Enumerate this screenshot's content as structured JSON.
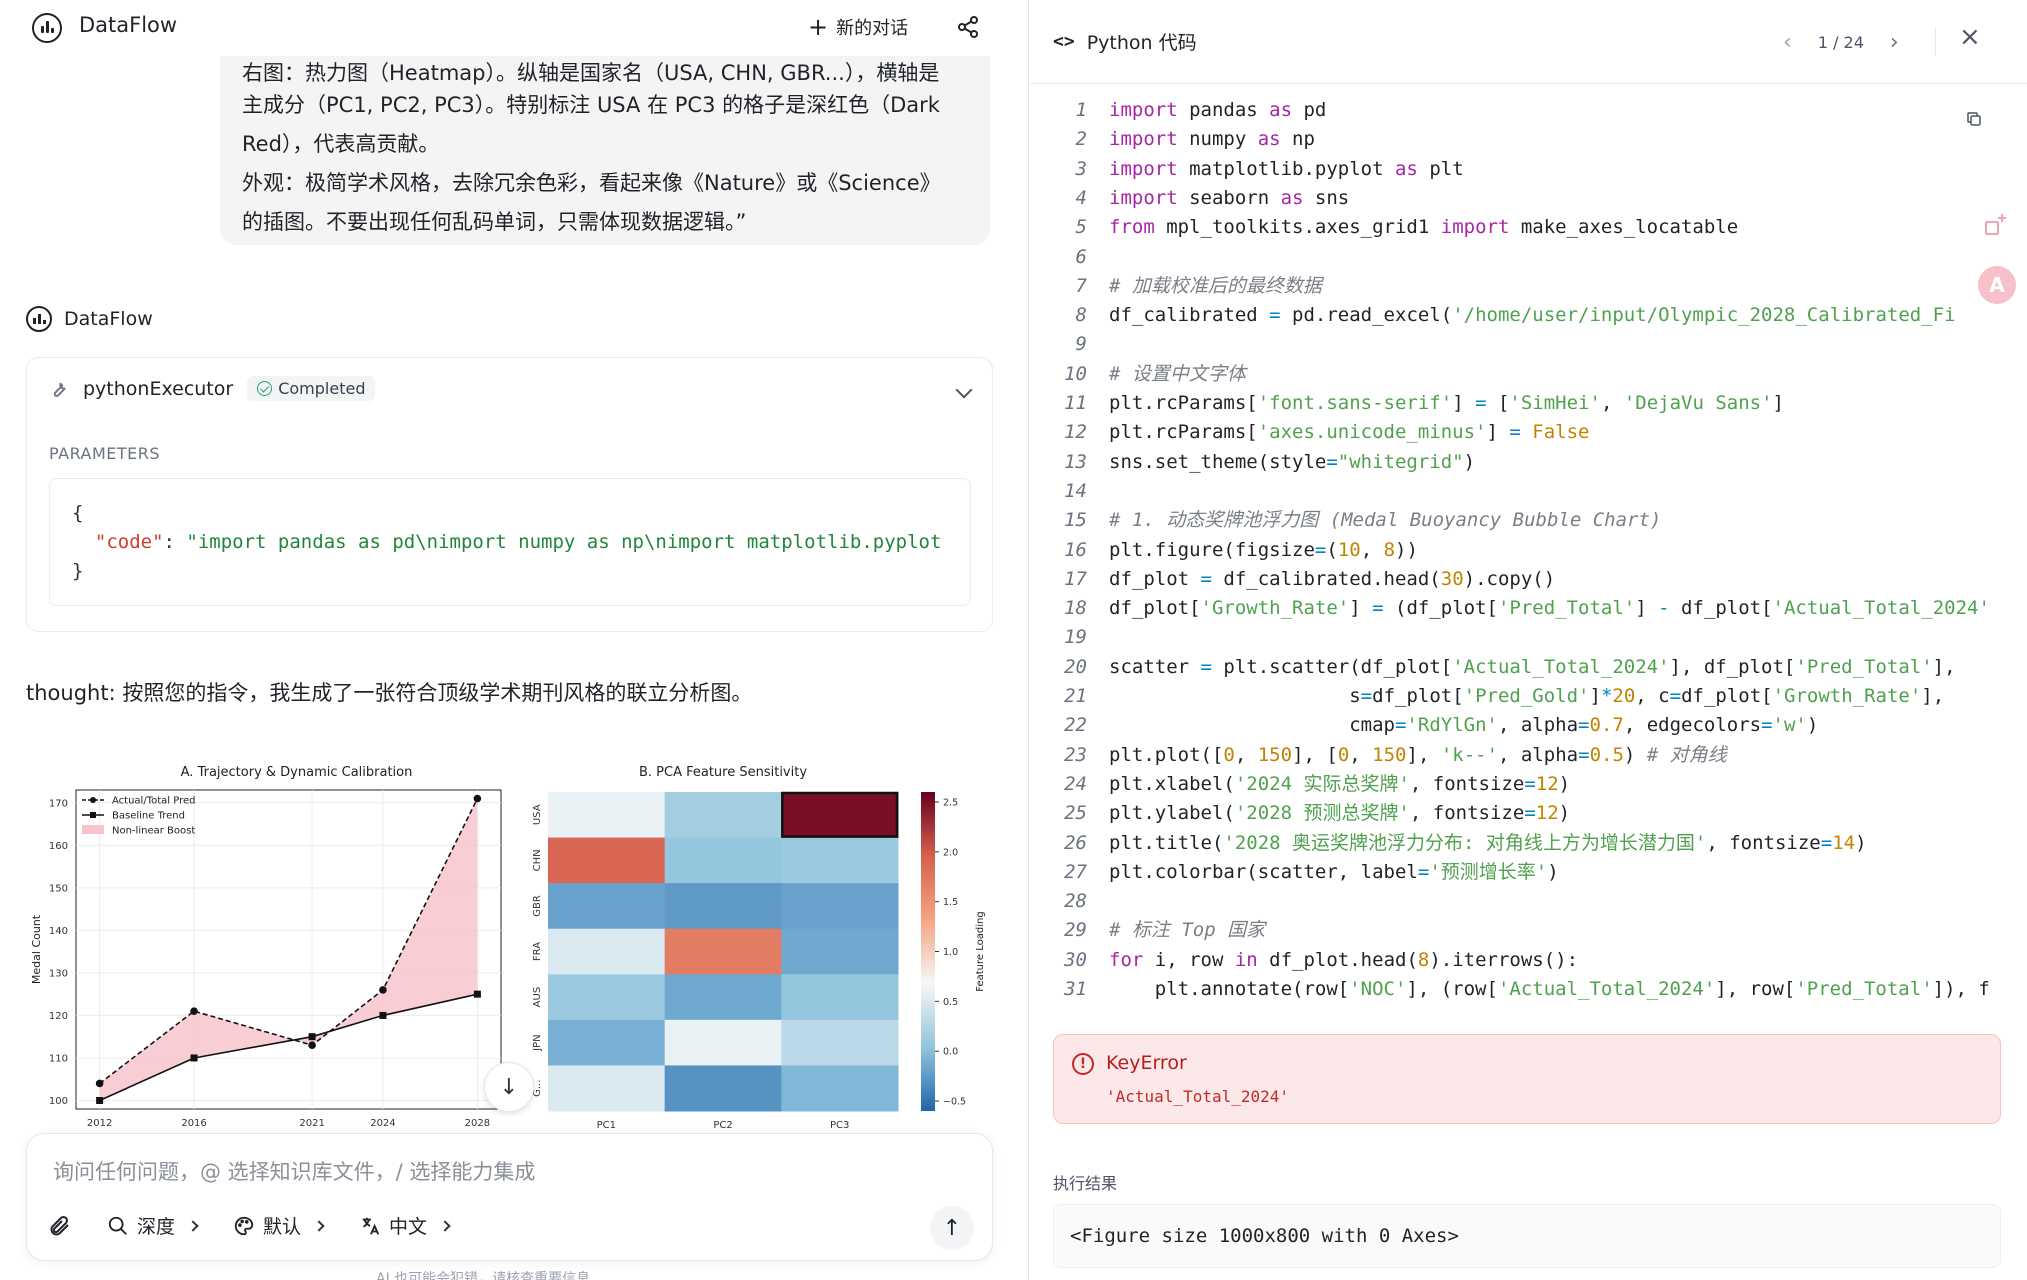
{
  "app": {
    "name": "DataFlow"
  },
  "header": {
    "new_chat_label": "新的对话",
    "share_icon": "share-icon"
  },
  "user_message": {
    "cut_line": "右图：热力图（Heatmap）。纵轴是国家名（USA, CHN, GBR...），横轴是",
    "lines": [
      "主成分（PC1, PC2, PC3）。特别标注 USA 在 PC3 的格子是深红色（Dark",
      "Red），代表高贡献。",
      "外观：极简学术风格，去除冗余色彩，看起来像《Nature》或《Science》",
      "的插图。不要出现任何乱码单词，只需体现数据逻辑。”"
    ]
  },
  "assistant": {
    "name": "DataFlow",
    "tool_call": {
      "name": "pythonExecutor",
      "status": "Completed",
      "params_label": "PARAMETERS",
      "open_brace": "{",
      "code_key": "\"code\"",
      "colon": ": ",
      "code_value": "\"import pandas as pd\\nimport numpy as np\\nimport matplotlib.pyplot",
      "close_brace": "}"
    },
    "thought": "thought: 按照您的指令，我生成了一张符合顶级学术期刊风格的联立分析图。"
  },
  "chart_data": [
    {
      "type": "line",
      "title": "A. Trajectory & Dynamic Calibration",
      "xlabel": "",
      "ylabel": "Medal Count",
      "x": [
        "2012",
        "2016",
        "2021",
        "2024",
        "2028"
      ],
      "x_numeric": [
        2012,
        2016,
        2021,
        2024,
        2028
      ],
      "ylim": [
        98,
        173
      ],
      "yticks": [
        100,
        110,
        120,
        130,
        140,
        150,
        160,
        170
      ],
      "series": [
        {
          "name": "Actual/Total Pred",
          "values": [
            104,
            121,
            113,
            126,
            171
          ],
          "style": "dashed",
          "marker": "circle"
        },
        {
          "name": "Baseline Trend",
          "values": [
            100,
            110,
            115,
            120,
            125
          ],
          "style": "solid",
          "marker": "square"
        }
      ],
      "fill": {
        "name": "Non-linear Boost",
        "color": "#f7c4cc"
      },
      "legend": "top-left",
      "grid": true
    },
    {
      "type": "heatmap",
      "title": "B. PCA Feature Sensitivity",
      "rows": [
        "USA",
        "CHN",
        "GBR",
        "FRA",
        "AUS",
        "JPN",
        "GER"
      ],
      "row_labels_shown": [
        "USA",
        "CHN",
        "GBR",
        "FRA",
        "AUS",
        "JPN",
        "G..."
      ],
      "columns": [
        "PC1",
        "PC2",
        "PC3"
      ],
      "values": [
        [
          0.6,
          0.15,
          2.5
        ],
        [
          1.9,
          0.05,
          0.1
        ],
        [
          -0.2,
          -0.25,
          -0.2
        ],
        [
          0.5,
          1.7,
          -0.15
        ],
        [
          0.1,
          -0.15,
          0.05
        ],
        [
          -0.1,
          0.6,
          0.3
        ],
        [
          0.5,
          -0.3,
          -0.05
        ]
      ],
      "highlight": {
        "row": "USA",
        "column": "PC3"
      },
      "colorbar": {
        "label": "Feature Loading",
        "ticks": [
          2.5,
          2.0,
          1.5,
          1.0,
          0.5,
          0.0,
          -0.5
        ],
        "tick_labels": [
          "2.5",
          "2.0",
          "1.5",
          "1.0",
          "0.5",
          "0.0",
          "−0.5"
        ],
        "range": [
          -0.6,
          2.6
        ]
      },
      "colormap": "RdBu_r"
    }
  ],
  "composer": {
    "placeholder": "询问任何问题，@ 选择知识库文件，/ 选择能力集成",
    "attach_icon": "paperclip-icon",
    "tools": [
      {
        "label": "深度",
        "icon": "search-icon"
      },
      {
        "label": "默认",
        "icon": "palette-icon"
      },
      {
        "label": "中文",
        "icon": "translate-icon"
      }
    ],
    "send_icon": "arrow-up-icon",
    "footer": "AI 也可能会犯错，请核查重要信息"
  },
  "code_panel": {
    "title": "Python 代码",
    "pager": "1 / 24",
    "lines": [
      [
        [
          "kw",
          "import"
        ],
        [
          "tx",
          " pandas "
        ],
        [
          "kw",
          "as"
        ],
        [
          "tx",
          " pd"
        ]
      ],
      [
        [
          "kw",
          "import"
        ],
        [
          "tx",
          " numpy "
        ],
        [
          "kw",
          "as"
        ],
        [
          "tx",
          " np"
        ]
      ],
      [
        [
          "kw",
          "import"
        ],
        [
          "tx",
          " matplotlib.pyplot "
        ],
        [
          "kw",
          "as"
        ],
        [
          "tx",
          " plt"
        ]
      ],
      [
        [
          "kw",
          "import"
        ],
        [
          "tx",
          " seaborn "
        ],
        [
          "kw",
          "as"
        ],
        [
          "tx",
          " sns"
        ]
      ],
      [
        [
          "kw",
          "from"
        ],
        [
          "tx",
          " mpl_toolkits.axes_grid1 "
        ],
        [
          "kw",
          "import"
        ],
        [
          "tx",
          " make_axes_locatable"
        ]
      ],
      [],
      [
        [
          "cm",
          "# 加载校准后的最终数据"
        ]
      ],
      [
        [
          "tx",
          "df_calibrated "
        ],
        [
          "op",
          "="
        ],
        [
          "tx",
          " pd.read_excel("
        ],
        [
          "st",
          "'/home/user/input/Olympic_2028_Calibrated_Fi"
        ]
      ],
      [],
      [
        [
          "cm",
          "# 设置中文字体"
        ]
      ],
      [
        [
          "tx",
          "plt.rcParams["
        ],
        [
          "st",
          "'font.sans-serif'"
        ],
        [
          "tx",
          "] "
        ],
        [
          "op",
          "="
        ],
        [
          "tx",
          " ["
        ],
        [
          "st",
          "'SimHei'"
        ],
        [
          "tx",
          ", "
        ],
        [
          "st",
          "'DejaVu Sans'"
        ],
        [
          "tx",
          "]"
        ]
      ],
      [
        [
          "tx",
          "plt.rcParams["
        ],
        [
          "st",
          "'axes.unicode_minus'"
        ],
        [
          "tx",
          "] "
        ],
        [
          "op",
          "="
        ],
        [
          "tx",
          " "
        ],
        [
          "nu",
          "False"
        ]
      ],
      [
        [
          "tx",
          "sns.set_theme(style"
        ],
        [
          "op",
          "="
        ],
        [
          "st",
          "\"whitegrid\""
        ],
        [
          "tx",
          ")"
        ]
      ],
      [],
      [
        [
          "cm",
          "# 1. 动态奖牌池浮力图 (Medal Buoyancy Bubble Chart)"
        ]
      ],
      [
        [
          "tx",
          "plt.figure(figsize"
        ],
        [
          "op",
          "="
        ],
        [
          "tx",
          "("
        ],
        [
          "nu",
          "10"
        ],
        [
          "tx",
          ", "
        ],
        [
          "nu",
          "8"
        ],
        [
          "tx",
          "))"
        ]
      ],
      [
        [
          "tx",
          "df_plot "
        ],
        [
          "op",
          "="
        ],
        [
          "tx",
          " df_calibrated.head("
        ],
        [
          "nu",
          "30"
        ],
        [
          "tx",
          ").copy()"
        ]
      ],
      [
        [
          "tx",
          "df_plot["
        ],
        [
          "st",
          "'Growth_Rate'"
        ],
        [
          "tx",
          "] "
        ],
        [
          "op",
          "="
        ],
        [
          "tx",
          " (df_plot["
        ],
        [
          "st",
          "'Pred_Total'"
        ],
        [
          "tx",
          "] "
        ],
        [
          "op",
          "-"
        ],
        [
          "tx",
          " df_plot["
        ],
        [
          "st",
          "'Actual_Total_2024'"
        ]
      ],
      [],
      [
        [
          "tx",
          "scatter "
        ],
        [
          "op",
          "="
        ],
        [
          "tx",
          " plt.scatter(df_plot["
        ],
        [
          "st",
          "'Actual_Total_2024'"
        ],
        [
          "tx",
          "], df_plot["
        ],
        [
          "st",
          "'Pred_Total'"
        ],
        [
          "tx",
          "],"
        ]
      ],
      [
        [
          "tx",
          "                     s"
        ],
        [
          "op",
          "="
        ],
        [
          "tx",
          "df_plot["
        ],
        [
          "st",
          "'Pred_Gold'"
        ],
        [
          "tx",
          "]"
        ],
        [
          "op",
          "*"
        ],
        [
          "nu",
          "20"
        ],
        [
          "tx",
          ", c"
        ],
        [
          "op",
          "="
        ],
        [
          "tx",
          "df_plot["
        ],
        [
          "st",
          "'Growth_Rate'"
        ],
        [
          "tx",
          "],"
        ]
      ],
      [
        [
          "tx",
          "                     cmap"
        ],
        [
          "op",
          "="
        ],
        [
          "st",
          "'RdYlGn'"
        ],
        [
          "tx",
          ", alpha"
        ],
        [
          "op",
          "="
        ],
        [
          "nu",
          "0.7"
        ],
        [
          "tx",
          ", edgecolors"
        ],
        [
          "op",
          "="
        ],
        [
          "st",
          "'w'"
        ],
        [
          "tx",
          ")"
        ]
      ],
      [
        [
          "tx",
          "plt.plot(["
        ],
        [
          "nu",
          "0"
        ],
        [
          "tx",
          ", "
        ],
        [
          "nu",
          "150"
        ],
        [
          "tx",
          "], ["
        ],
        [
          "nu",
          "0"
        ],
        [
          "tx",
          ", "
        ],
        [
          "nu",
          "150"
        ],
        [
          "tx",
          "], "
        ],
        [
          "st",
          "'k--'"
        ],
        [
          "tx",
          ", alpha"
        ],
        [
          "op",
          "="
        ],
        [
          "nu",
          "0.5"
        ],
        [
          "tx",
          ") "
        ],
        [
          "cm",
          "# 对角线"
        ]
      ],
      [
        [
          "tx",
          "plt.xlabel("
        ],
        [
          "st",
          "'2024 实际总奖牌'"
        ],
        [
          "tx",
          ", fontsize"
        ],
        [
          "op",
          "="
        ],
        [
          "nu",
          "12"
        ],
        [
          "tx",
          ")"
        ]
      ],
      [
        [
          "tx",
          "plt.ylabel("
        ],
        [
          "st",
          "'2028 预测总奖牌'"
        ],
        [
          "tx",
          ", fontsize"
        ],
        [
          "op",
          "="
        ],
        [
          "nu",
          "12"
        ],
        [
          "tx",
          ")"
        ]
      ],
      [
        [
          "tx",
          "plt.title("
        ],
        [
          "st",
          "'2028 奥运奖牌池浮力分布: 对角线上方为增长潜力国'"
        ],
        [
          "tx",
          ", fontsize"
        ],
        [
          "op",
          "="
        ],
        [
          "nu",
          "14"
        ],
        [
          "tx",
          ")"
        ]
      ],
      [
        [
          "tx",
          "plt.colorbar(scatter, label"
        ],
        [
          "op",
          "="
        ],
        [
          "st",
          "'预测增长率'"
        ],
        [
          "tx",
          ")"
        ]
      ],
      [],
      [
        [
          "cm",
          "# 标注 Top 国家"
        ]
      ],
      [
        [
          "kw",
          "for"
        ],
        [
          "tx",
          " i, row "
        ],
        [
          "kw",
          "in"
        ],
        [
          "tx",
          " df_plot.head("
        ],
        [
          "nu",
          "8"
        ],
        [
          "tx",
          ").iterrows():"
        ]
      ],
      [
        [
          "tx",
          "    plt.annotate(row["
        ],
        [
          "st",
          "'NOC'"
        ],
        [
          "tx",
          "], (row["
        ],
        [
          "st",
          "'Actual_Total_2024'"
        ],
        [
          "tx",
          "], row["
        ],
        [
          "st",
          "'Pred_Total'"
        ],
        [
          "tx",
          "]), f"
        ]
      ]
    ],
    "error": {
      "title": "KeyError",
      "message": "'Actual_Total_2024'"
    },
    "result_label": "执行结果",
    "result_output": "<Figure size 1000x800 with 0 Axes>"
  },
  "colors": {
    "error_bg": "#fce8e8",
    "error_text": "#c62828",
    "keyword": "#a626a4",
    "string": "#50a14f",
    "number": "#c18401",
    "success": "#22a06b"
  }
}
